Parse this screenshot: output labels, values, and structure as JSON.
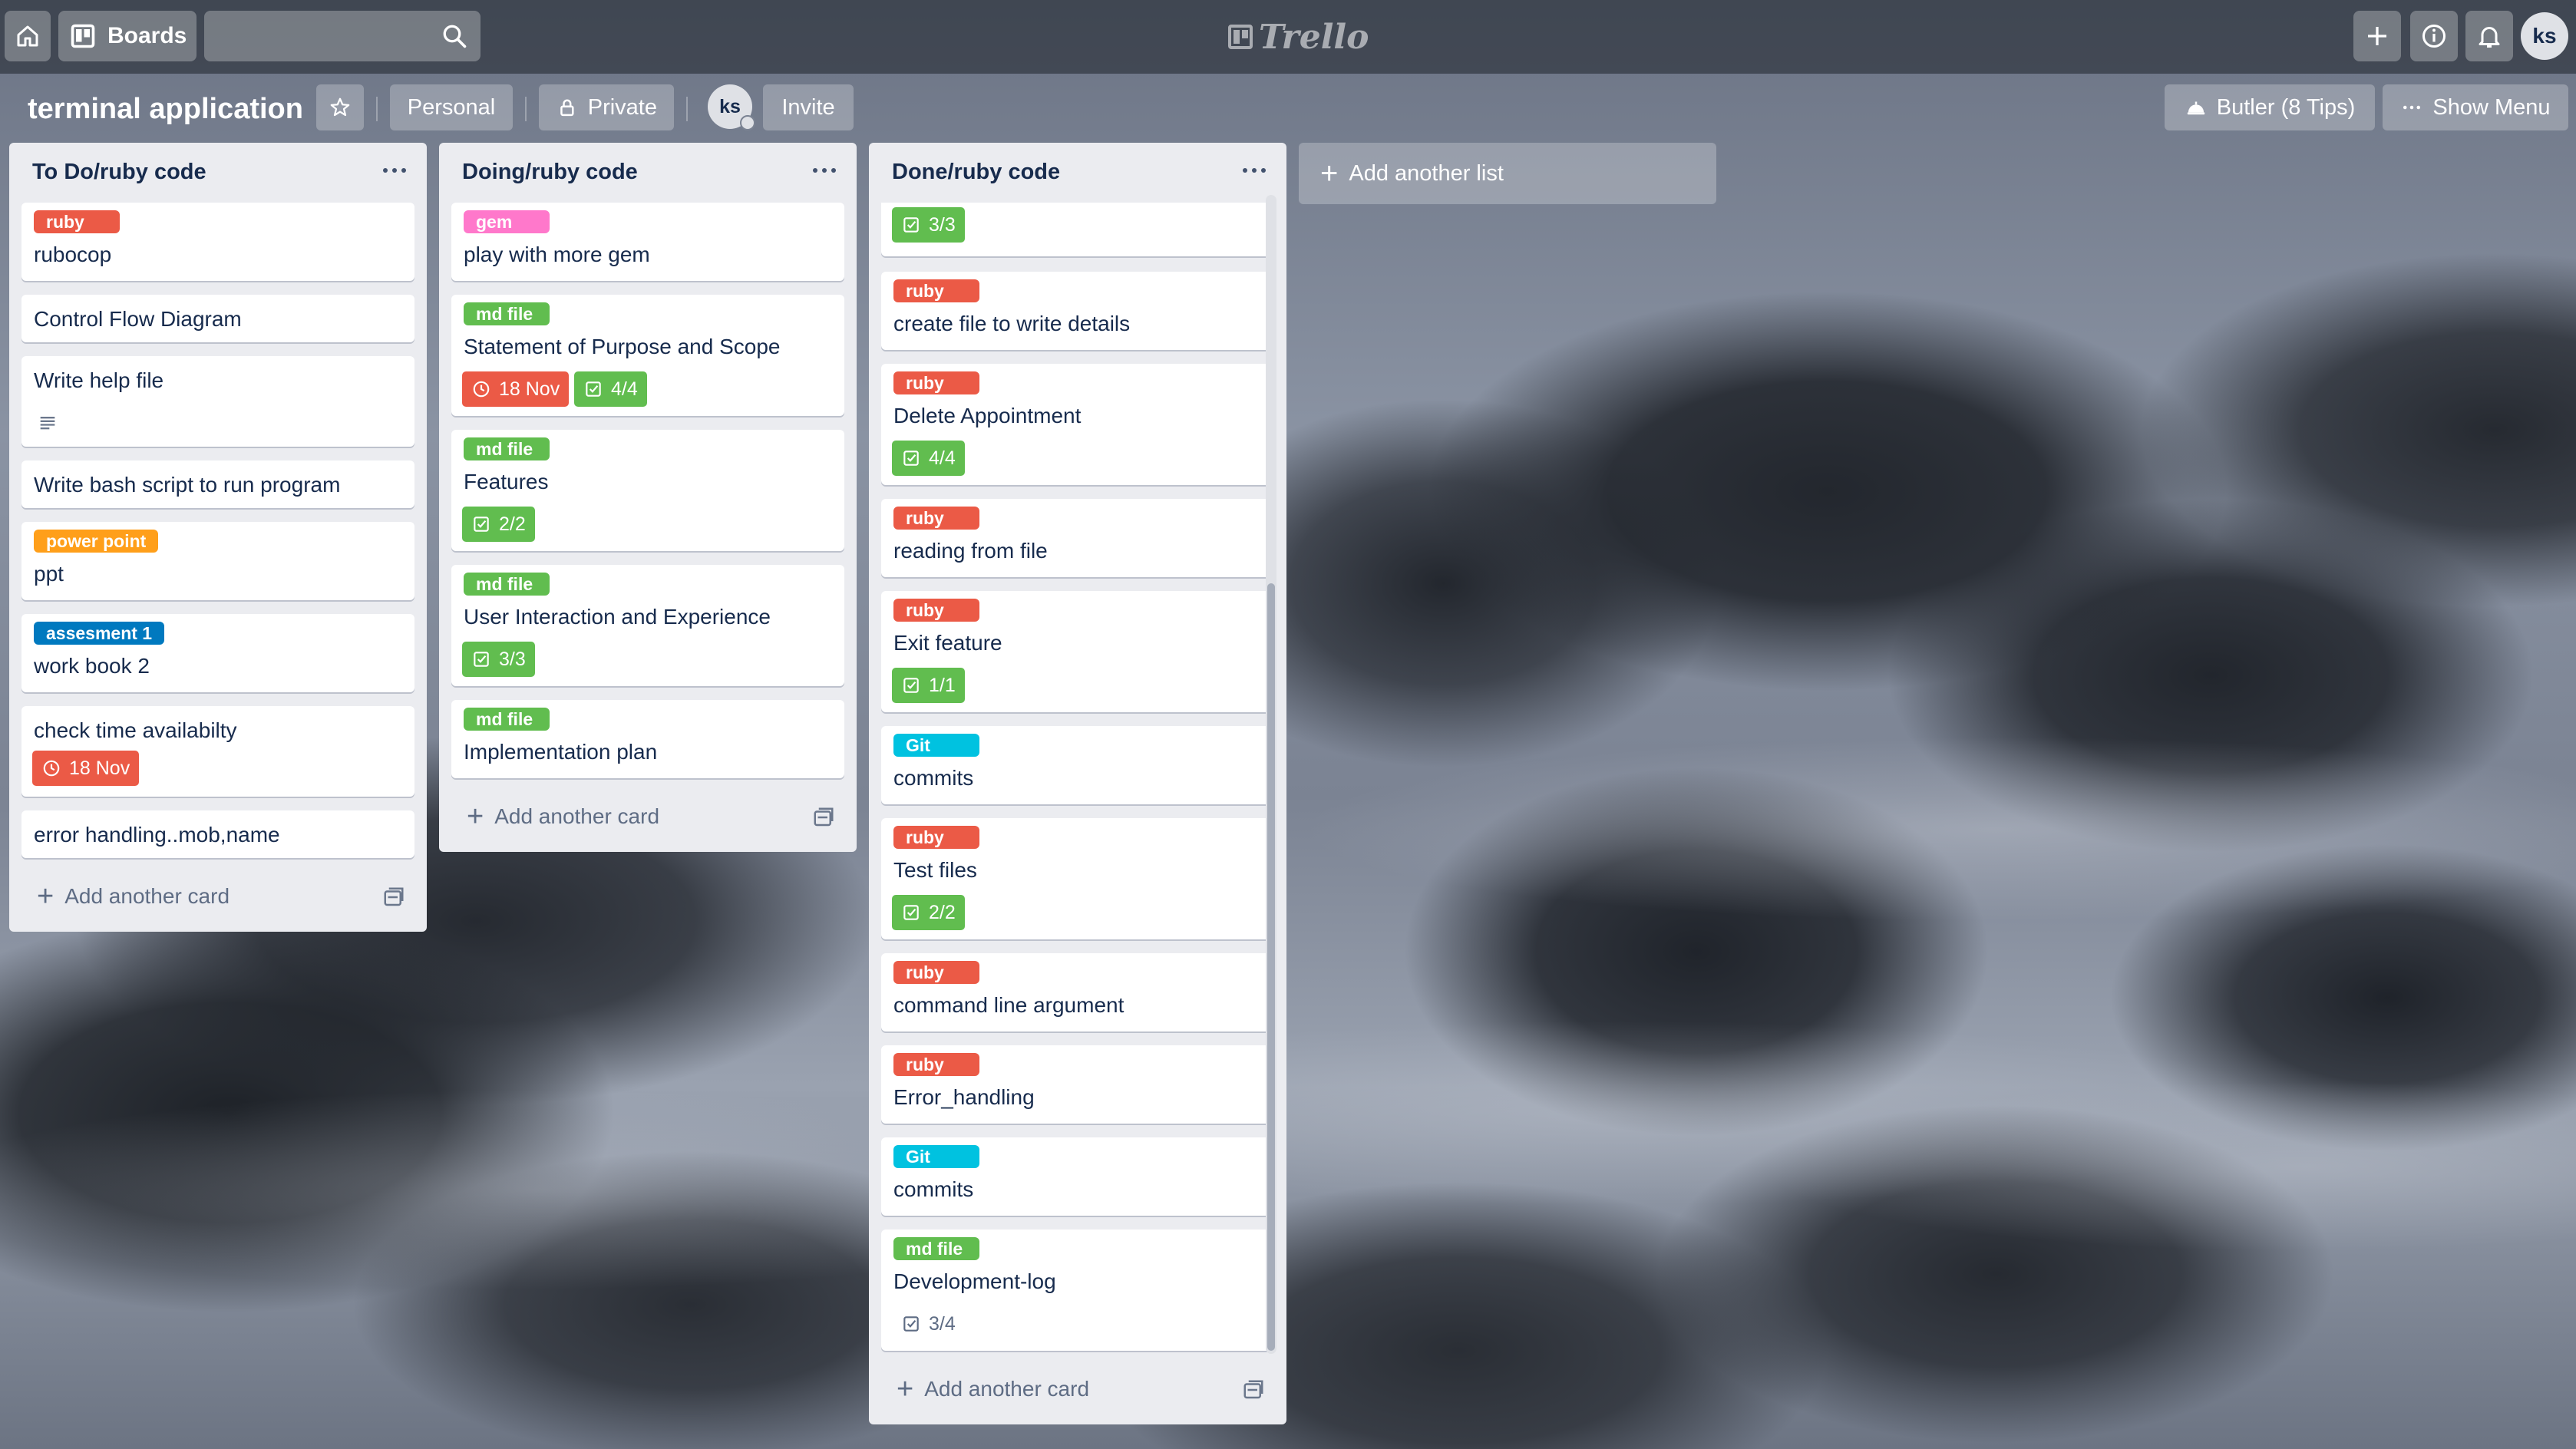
{
  "header": {
    "boards_label": "Boards",
    "logo_text": "Trello",
    "avatar_initials": "ks"
  },
  "board": {
    "title": "terminal application",
    "visibility_team": "Personal",
    "visibility_privacy": "Private",
    "member_initials": "ks",
    "invite_label": "Invite",
    "butler_label": "Butler (8 Tips)",
    "menu_label": "Show Menu",
    "add_list_label": "Add another list"
  },
  "colors": {
    "ruby": "#eb5a46",
    "gem": "#ff78cb",
    "md_file": "#61bd4f",
    "power_point": "#ff9f1a",
    "assesment": "#0079bf",
    "git": "#00c2e0",
    "due": "#eb5a46",
    "checklist_done": "#61bd4f"
  },
  "lists": [
    {
      "title": "To Do/ruby code",
      "add_card": "Add another card",
      "cards": [
        {
          "label": "ruby",
          "title": "rubocop"
        },
        {
          "title": "Control Flow Diagram"
        },
        {
          "title": "Write help file",
          "icon": "description-icon"
        },
        {
          "title": "Write bash script to run program"
        },
        {
          "label": "power point",
          "title": "ppt"
        },
        {
          "label": "assesment 1",
          "title": "work book 2"
        },
        {
          "title": "check time availabilty",
          "due": "18 Nov"
        },
        {
          "title": "error handling..mob,name"
        }
      ]
    },
    {
      "title": "Doing/ruby code",
      "add_card": "Add another card",
      "cards": [
        {
          "label": "gem",
          "title": "play with more gem"
        },
        {
          "label": "md file",
          "title": "Statement of Purpose and Scope",
          "due": "18 Nov",
          "checklist": "4/4"
        },
        {
          "label": "md file",
          "title": "Features",
          "checklist": "2/2"
        },
        {
          "label": "md file",
          "title": "User Interaction and Experience",
          "checklist": "3/3"
        },
        {
          "label": "md file",
          "title": "Implementation plan"
        }
      ]
    },
    {
      "title": "Done/ruby code",
      "add_card": "Add another card",
      "cards": [
        {
          "checklist": "3/3"
        },
        {
          "label": "ruby",
          "title": "create file to write details"
        },
        {
          "label": "ruby",
          "title": "Delete Appointment",
          "checklist": "4/4"
        },
        {
          "label": "ruby",
          "title": "reading from file"
        },
        {
          "label": "ruby",
          "title": "Exit feature",
          "checklist": "1/1"
        },
        {
          "label": "Git",
          "title": "commits"
        },
        {
          "label": "ruby",
          "title": "Test files",
          "checklist": "2/2"
        },
        {
          "label": "ruby",
          "title": "command line argument"
        },
        {
          "label": "ruby",
          "title": "Error_handling"
        },
        {
          "label": "Git",
          "title": "commits"
        },
        {
          "label": "md file",
          "title": "Development-log",
          "checklist": "3/4"
        }
      ]
    }
  ]
}
